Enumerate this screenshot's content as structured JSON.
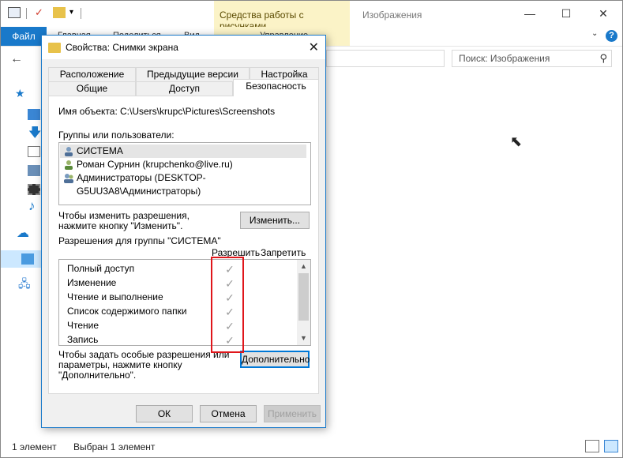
{
  "explorer": {
    "context_tab": "Средства работы с рисунками",
    "title": "Изображения",
    "ribbon_tabs": [
      "Файл",
      "Главная",
      "Поделиться",
      "Вид",
      "Управление"
    ],
    "search_placeholder": "Поиск: Изображения",
    "status_items_count": "1 элемент",
    "status_selected": "Выбран 1 элемент",
    "accent_color": "#1979ca",
    "context_color": "#fbf3c7"
  },
  "dialog": {
    "title": "Свойства: Снимки экрана",
    "tabs_row1": [
      "Расположение",
      "Предыдущие версии",
      "Настройка"
    ],
    "tabs_row2": [
      "Общие",
      "Доступ",
      "Безопасность"
    ],
    "active_tab": "Безопасность",
    "object_label": "Имя объекта:",
    "object_path": "C:\\Users\\krupc\\Pictures\\Screenshots",
    "groups_label": "Группы или пользователи:",
    "users": [
      "СИСТЕМА",
      "Роман Сурнин (krupchenko@live.ru)",
      "Администраторы (DESKTOP-G5UU3A8\\Администраторы)"
    ],
    "change_hint_line1": "Чтобы изменить разрешения,",
    "change_hint_line2": "нажмите кнопку \"Изменить\".",
    "change_button": "Изменить...",
    "permissions_label": "Разрешения для группы \"СИСТЕМА\"",
    "allow_header": "Разрешить",
    "deny_header": "Запретить",
    "permissions": [
      "Полный доступ",
      "Изменение",
      "Чтение и выполнение",
      "Список содержимого папки",
      "Чтение",
      "Запись"
    ],
    "advanced_hint_line1": "Чтобы задать особые разрешения или",
    "advanced_hint_line2": "параметры, нажмите кнопку",
    "advanced_hint_line3": "\"Дополнительно\".",
    "advanced_button": "Дополнительно",
    "ok_button": "ОК",
    "cancel_button": "Отмена",
    "apply_button": "Применить",
    "highlight_color": "#e0161b"
  }
}
